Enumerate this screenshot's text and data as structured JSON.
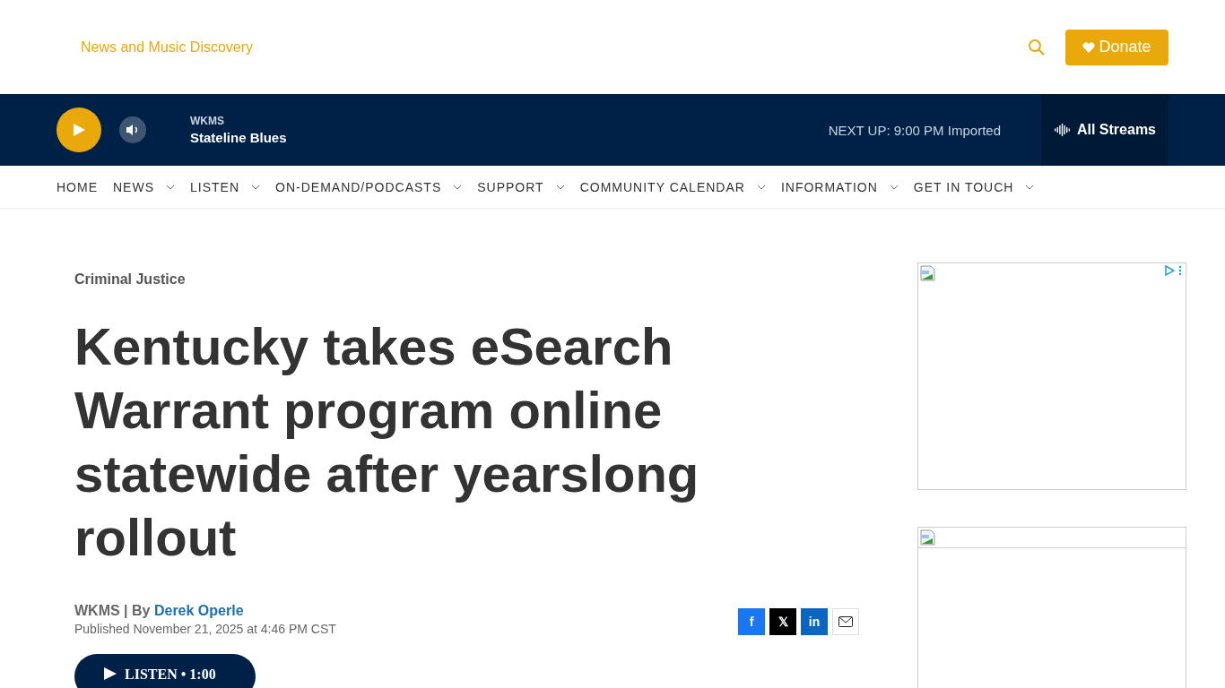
{
  "header": {
    "tagline": "News and Music Discovery",
    "donate": "Donate"
  },
  "player": {
    "station": "WKMS",
    "show": "Stateline Blues",
    "next_up": "NEXT UP:",
    "next_time": "9:00 PM",
    "next_show": "Imported",
    "streams": "All Streams"
  },
  "nav": [
    {
      "label": "HOME",
      "dropdown": false
    },
    {
      "label": "NEWS",
      "dropdown": true
    },
    {
      "label": "LISTEN",
      "dropdown": true
    },
    {
      "label": "ON-DEMAND/PODCASTS",
      "dropdown": true
    },
    {
      "label": "SUPPORT",
      "dropdown": true
    },
    {
      "label": "COMMUNITY CALENDAR",
      "dropdown": true
    },
    {
      "label": "INFORMATION",
      "dropdown": true
    },
    {
      "label": "GET IN TOUCH",
      "dropdown": true
    }
  ],
  "article": {
    "category": "Criminal Justice",
    "headline": "Kentucky takes eSearch Warrant program online statewide after yearslong rollout",
    "source": "WKMS | By",
    "author": "Derek Operle",
    "published": "Published November 21, 2025 at 4:46 PM CST",
    "listen": "LISTEN",
    "listen_sep": "•",
    "listen_time": "1:00"
  },
  "share": [
    {
      "kind": "facebook",
      "glyph": "f"
    },
    {
      "kind": "x",
      "glyph": "𝕏"
    },
    {
      "kind": "linkedin",
      "glyph": "in"
    },
    {
      "kind": "email"
    }
  ],
  "ads": [
    {
      "kind": "adchoices"
    },
    {
      "kind": "strip"
    }
  ]
}
